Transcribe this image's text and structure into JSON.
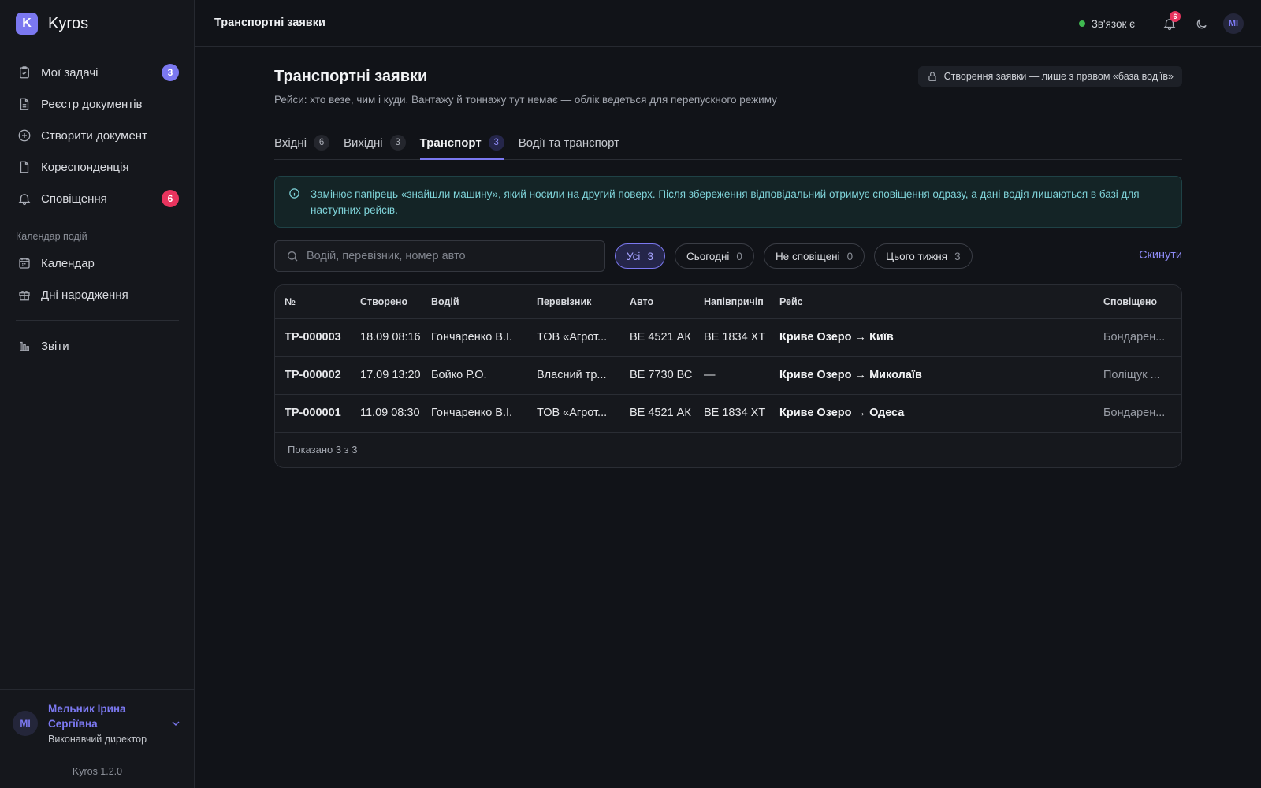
{
  "brand": {
    "logo_letter": "K",
    "name": "Kyros"
  },
  "sidebar": {
    "items": [
      {
        "label": "Мої задачі",
        "badge": "3"
      },
      {
        "label": "Реєстр документів"
      },
      {
        "label": "Створити документ"
      },
      {
        "label": "Кореспонденція"
      },
      {
        "label": "Сповіщення",
        "badge": "6"
      }
    ],
    "section_label": "Календар подій",
    "calendar_items": [
      {
        "label": "Календар"
      },
      {
        "label": "Дні народження"
      }
    ],
    "reports": {
      "label": "Звіти"
    }
  },
  "user": {
    "initials": "МІ",
    "name": "Мельник Ірина Сергіївна",
    "role": "Виконавчий директор"
  },
  "version": "Kyros 1.2.0",
  "topbar": {
    "title": "Транспортні заявки",
    "status": "Зв'язок є",
    "notifications_count": "6",
    "avatar_initials": "МІ"
  },
  "page": {
    "title": "Транспортні заявки",
    "subtitle": "Рейси: хто везе, чим і куди. Вантажу й тоннажу тут немає — облік ведеться для перепускного режиму",
    "permission_note": "Створення заявки — лише з правом «база водіїв»"
  },
  "tabs": [
    {
      "label": "Вхідні",
      "count": "6"
    },
    {
      "label": "Вихідні",
      "count": "3"
    },
    {
      "label": "Транспорт",
      "count": "3"
    },
    {
      "label": "Водії та транспорт"
    }
  ],
  "info": "Замінює папірець «знайшли машину», який носили на другий поверх. Після збереження відповідальний отримує сповіщення одразу, а дані водія лишаються в базі для наступних рейсів.",
  "filters": {
    "search_placeholder": "Водій, перевізник, номер авто",
    "chips": [
      {
        "label": "Усі",
        "count": "3"
      },
      {
        "label": "Сьогодні",
        "count": "0"
      },
      {
        "label": "Не сповіщені",
        "count": "0"
      },
      {
        "label": "Цього тижня",
        "count": "3"
      }
    ],
    "reset": "Скинути"
  },
  "table": {
    "columns": [
      "№",
      "Створено",
      "Водій",
      "Перевізник",
      "Авто",
      "Напівпричіп",
      "Рейс",
      "Сповіщено"
    ],
    "rows": [
      [
        "ТР-000003",
        "18.09 08:16",
        "Гончаренко В.І.",
        "ТОВ «Агрот...",
        "ВЕ 4521 АК",
        "ВЕ 1834 ХТ",
        "Криве Озеро → Київ",
        "Бондарен..."
      ],
      [
        "ТР-000002",
        "17.09 13:20",
        "Бойко Р.О.",
        "Власний тр...",
        "ВЕ 7730 ВС",
        "—",
        "Криве Озеро → Миколаїв",
        "Поліщук ..."
      ],
      [
        "ТР-000001",
        "11.09 08:30",
        "Гончаренко В.І.",
        "ТОВ «Агрот...",
        "ВЕ 4521 АК",
        "ВЕ 1834 ХТ",
        "Криве Озеро → Одеса",
        "Бондарен..."
      ]
    ],
    "footer": "Показано 3 з 3"
  }
}
